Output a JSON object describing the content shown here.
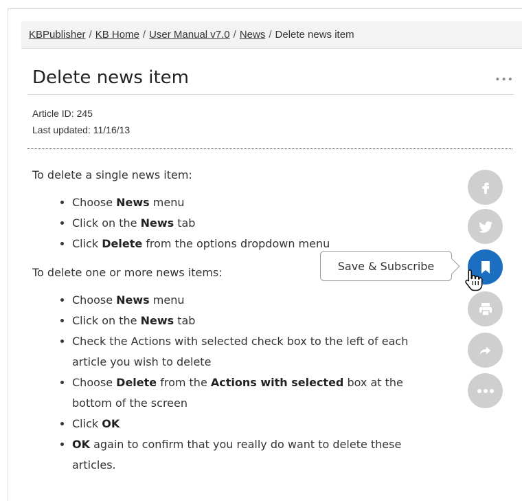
{
  "breadcrumb": {
    "items": [
      "KBPublisher",
      "KB Home",
      "User Manual v7.0",
      "News"
    ],
    "current": "Delete news item",
    "separator": "/"
  },
  "article": {
    "title": "Delete news item",
    "menu_label": "•••",
    "id_label": "Article ID: 245",
    "updated_label": "Last updated: 11/16/13"
  },
  "content": {
    "intro1": "To delete a single news item:",
    "list1": [
      {
        "pre": "Choose ",
        "bold": "News",
        "post": " menu"
      },
      {
        "pre": "Click on the ",
        "bold": "News",
        "post": " tab"
      },
      {
        "pre": "Click ",
        "bold": "Delete",
        "post": " from the options dropdown menu"
      }
    ],
    "intro2": "To delete one or more news items:",
    "list2": [
      {
        "pre": "Choose ",
        "bold": "News",
        "post": " menu"
      },
      {
        "pre": "Click on the ",
        "bold": "News",
        "post": " tab"
      },
      {
        "pre": "Check the Actions with selected check box to the left of each article you wish to delete",
        "bold": "",
        "post": ""
      },
      {
        "pre": "Choose ",
        "bold": "Delete",
        "post": " from the ",
        "bold2": "Actions with selected",
        "post2": " box at the bottom of the screen"
      },
      {
        "pre": "Click ",
        "bold": "OK",
        "post": ""
      },
      {
        "pre": "",
        "bold": "OK",
        "post": " again to confirm that you really do want to delete these articles."
      }
    ]
  },
  "share": {
    "tooltip": "Save & Subscribe",
    "buttons": [
      "facebook-icon",
      "twitter-icon",
      "bookmark-icon",
      "print-icon",
      "share-icon",
      "more-icon"
    ],
    "inactive_color": "#cfcfcf",
    "active_color": "#1c6fc0"
  }
}
